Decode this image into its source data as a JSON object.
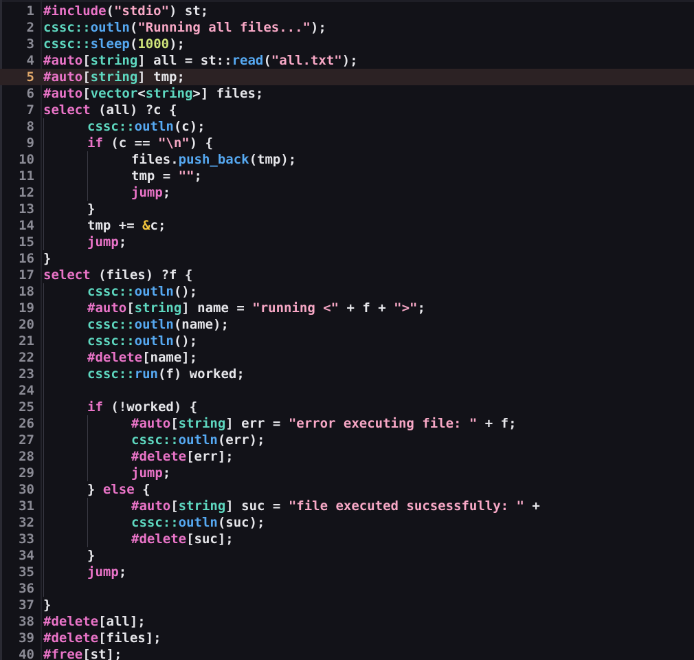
{
  "editor": {
    "current_line": 5,
    "colors": {
      "background": "#121218",
      "keyword": "#ea74c8",
      "namespace": "#5ed8c0",
      "function": "#56a9f2",
      "string": "#f8a8c6",
      "number": "#cfe47a",
      "operator": "#f2c53d",
      "text": "#e6e6ea",
      "line_number": "#8b8b95",
      "current_line_number": "#e0a86a",
      "current_line_highlight": "#2c2224"
    },
    "lines": [
      {
        "n": "1",
        "indent": 0,
        "tokens": [
          [
            "#include",
            "kw"
          ],
          [
            "(",
            "plain"
          ],
          [
            "\"stdio\"",
            "str"
          ],
          [
            ") st;",
            "plain"
          ]
        ]
      },
      {
        "n": "2",
        "indent": 0,
        "tokens": [
          [
            "cssc",
            "ns"
          ],
          [
            "::",
            "ns"
          ],
          [
            "outln",
            "fn"
          ],
          [
            "(",
            "plain"
          ],
          [
            "\"Running all files...\"",
            "str"
          ],
          [
            ");",
            "plain"
          ]
        ]
      },
      {
        "n": "3",
        "indent": 0,
        "tokens": [
          [
            "cssc",
            "ns"
          ],
          [
            "::",
            "ns"
          ],
          [
            "sleep",
            "fn"
          ],
          [
            "(",
            "plain"
          ],
          [
            "1000",
            "num"
          ],
          [
            ");",
            "plain"
          ]
        ]
      },
      {
        "n": "4",
        "indent": 0,
        "tokens": [
          [
            "#auto",
            "kw"
          ],
          [
            "[",
            "plain"
          ],
          [
            "string",
            "ns"
          ],
          [
            "] all = st::",
            "plain"
          ],
          [
            "read",
            "fn"
          ],
          [
            "(",
            "plain"
          ],
          [
            "\"all.txt\"",
            "str"
          ],
          [
            ");",
            "plain"
          ]
        ]
      },
      {
        "n": "5",
        "indent": 0,
        "tokens": [
          [
            "#auto",
            "kw"
          ],
          [
            "[",
            "plain"
          ],
          [
            "string",
            "ns"
          ],
          [
            "] tmp;",
            "plain"
          ]
        ]
      },
      {
        "n": "6",
        "indent": 0,
        "tokens": [
          [
            "#auto",
            "kw"
          ],
          [
            "[",
            "plain"
          ],
          [
            "vector",
            "ns"
          ],
          [
            "<",
            "plain"
          ],
          [
            "string",
            "ns"
          ],
          [
            ">] files;",
            "plain"
          ]
        ]
      },
      {
        "n": "7",
        "indent": 0,
        "tokens": [
          [
            "select",
            "kw"
          ],
          [
            " (all) ?c {",
            "plain"
          ]
        ]
      },
      {
        "n": "8",
        "indent": 1,
        "tokens": [
          [
            "cssc",
            "ns"
          ],
          [
            "::",
            "ns"
          ],
          [
            "outln",
            "fn"
          ],
          [
            "(c);",
            "plain"
          ]
        ]
      },
      {
        "n": "9",
        "indent": 1,
        "tokens": [
          [
            "if",
            "kw"
          ],
          [
            " (c == ",
            "plain"
          ],
          [
            "\"\\n\"",
            "str"
          ],
          [
            ") {",
            "plain"
          ]
        ]
      },
      {
        "n": "10",
        "indent": 2,
        "tokens": [
          [
            "files.",
            "plain"
          ],
          [
            "push_back",
            "fn"
          ],
          [
            "(tmp);",
            "plain"
          ]
        ]
      },
      {
        "n": "11",
        "indent": 2,
        "tokens": [
          [
            "tmp = ",
            "plain"
          ],
          [
            "\"\"",
            "str"
          ],
          [
            ";",
            "plain"
          ]
        ]
      },
      {
        "n": "12",
        "indent": 2,
        "tokens": [
          [
            "jump",
            "kw"
          ],
          [
            ";",
            "plain"
          ]
        ]
      },
      {
        "n": "13",
        "indent": 1,
        "tokens": [
          [
            "}",
            "plain"
          ]
        ]
      },
      {
        "n": "14",
        "indent": 1,
        "tokens": [
          [
            "tmp += ",
            "plain"
          ],
          [
            "&",
            "op"
          ],
          [
            "c;",
            "plain"
          ]
        ]
      },
      {
        "n": "15",
        "indent": 1,
        "tokens": [
          [
            "jump",
            "kw"
          ],
          [
            ";",
            "plain"
          ]
        ]
      },
      {
        "n": "16",
        "indent": 0,
        "tokens": [
          [
            "}",
            "plain"
          ]
        ]
      },
      {
        "n": "17",
        "indent": 0,
        "tokens": [
          [
            "select",
            "kw"
          ],
          [
            " (files) ?f {",
            "plain"
          ]
        ]
      },
      {
        "n": "18",
        "indent": 1,
        "tokens": [
          [
            "cssc",
            "ns"
          ],
          [
            "::",
            "ns"
          ],
          [
            "outln",
            "fn"
          ],
          [
            "();",
            "plain"
          ]
        ]
      },
      {
        "n": "19",
        "indent": 1,
        "tokens": [
          [
            "#auto",
            "kw"
          ],
          [
            "[",
            "plain"
          ],
          [
            "string",
            "ns"
          ],
          [
            "] name = ",
            "plain"
          ],
          [
            "\"running <\"",
            "str"
          ],
          [
            " + f + ",
            "plain"
          ],
          [
            "\">\"",
            "str"
          ],
          [
            ";",
            "plain"
          ]
        ]
      },
      {
        "n": "20",
        "indent": 1,
        "tokens": [
          [
            "cssc",
            "ns"
          ],
          [
            "::",
            "ns"
          ],
          [
            "outln",
            "fn"
          ],
          [
            "(name);",
            "plain"
          ]
        ]
      },
      {
        "n": "21",
        "indent": 1,
        "tokens": [
          [
            "cssc",
            "ns"
          ],
          [
            "::",
            "ns"
          ],
          [
            "outln",
            "fn"
          ],
          [
            "();",
            "plain"
          ]
        ]
      },
      {
        "n": "22",
        "indent": 1,
        "tokens": [
          [
            "#delete",
            "kw"
          ],
          [
            "[name];",
            "plain"
          ]
        ]
      },
      {
        "n": "23",
        "indent": 1,
        "tokens": [
          [
            "cssc",
            "ns"
          ],
          [
            "::",
            "ns"
          ],
          [
            "run",
            "fn"
          ],
          [
            "(f) worked;",
            "plain"
          ]
        ]
      },
      {
        "n": "24",
        "indent": 1,
        "tokens": []
      },
      {
        "n": "25",
        "indent": 1,
        "tokens": [
          [
            "if",
            "kw"
          ],
          [
            " (!worked) {",
            "plain"
          ]
        ]
      },
      {
        "n": "26",
        "indent": 2,
        "tokens": [
          [
            "#auto",
            "kw"
          ],
          [
            "[",
            "plain"
          ],
          [
            "string",
            "ns"
          ],
          [
            "] err = ",
            "plain"
          ],
          [
            "\"error executing file: \"",
            "str"
          ],
          [
            " + f;",
            "plain"
          ]
        ]
      },
      {
        "n": "27",
        "indent": 2,
        "tokens": [
          [
            "cssc",
            "ns"
          ],
          [
            "::",
            "ns"
          ],
          [
            "outln",
            "fn"
          ],
          [
            "(err);",
            "plain"
          ]
        ]
      },
      {
        "n": "28",
        "indent": 2,
        "tokens": [
          [
            "#delete",
            "kw"
          ],
          [
            "[err];",
            "plain"
          ]
        ]
      },
      {
        "n": "29",
        "indent": 2,
        "tokens": [
          [
            "jump",
            "kw"
          ],
          [
            ";",
            "plain"
          ]
        ]
      },
      {
        "n": "30",
        "indent": 1,
        "tokens": [
          [
            "} ",
            "plain"
          ],
          [
            "else",
            "kw"
          ],
          [
            " {",
            "plain"
          ]
        ]
      },
      {
        "n": "31",
        "indent": 2,
        "tokens": [
          [
            "#auto",
            "kw"
          ],
          [
            "[",
            "plain"
          ],
          [
            "string",
            "ns"
          ],
          [
            "] suc = ",
            "plain"
          ],
          [
            "\"file executed sucsessfully: \"",
            "str"
          ],
          [
            " +",
            "plain"
          ]
        ]
      },
      {
        "n": "32",
        "indent": 2,
        "tokens": [
          [
            "cssc",
            "ns"
          ],
          [
            "::",
            "ns"
          ],
          [
            "outln",
            "fn"
          ],
          [
            "(suc);",
            "plain"
          ]
        ]
      },
      {
        "n": "33",
        "indent": 2,
        "tokens": [
          [
            "#delete",
            "kw"
          ],
          [
            "[suc];",
            "plain"
          ]
        ]
      },
      {
        "n": "34",
        "indent": 1,
        "tokens": [
          [
            "}",
            "plain"
          ]
        ]
      },
      {
        "n": "35",
        "indent": 1,
        "tokens": [
          [
            "jump",
            "kw"
          ],
          [
            ";",
            "plain"
          ]
        ]
      },
      {
        "n": "36",
        "indent": 1,
        "tokens": []
      },
      {
        "n": "37",
        "indent": 0,
        "tokens": [
          [
            "}",
            "plain"
          ]
        ]
      },
      {
        "n": "38",
        "indent": 0,
        "tokens": [
          [
            "#delete",
            "kw"
          ],
          [
            "[all];",
            "plain"
          ]
        ]
      },
      {
        "n": "39",
        "indent": 0,
        "tokens": [
          [
            "#delete",
            "kw"
          ],
          [
            "[files];",
            "plain"
          ]
        ]
      },
      {
        "n": "40",
        "indent": 0,
        "tokens": [
          [
            "#free",
            "kw"
          ],
          [
            "[st];",
            "plain"
          ]
        ]
      }
    ]
  }
}
